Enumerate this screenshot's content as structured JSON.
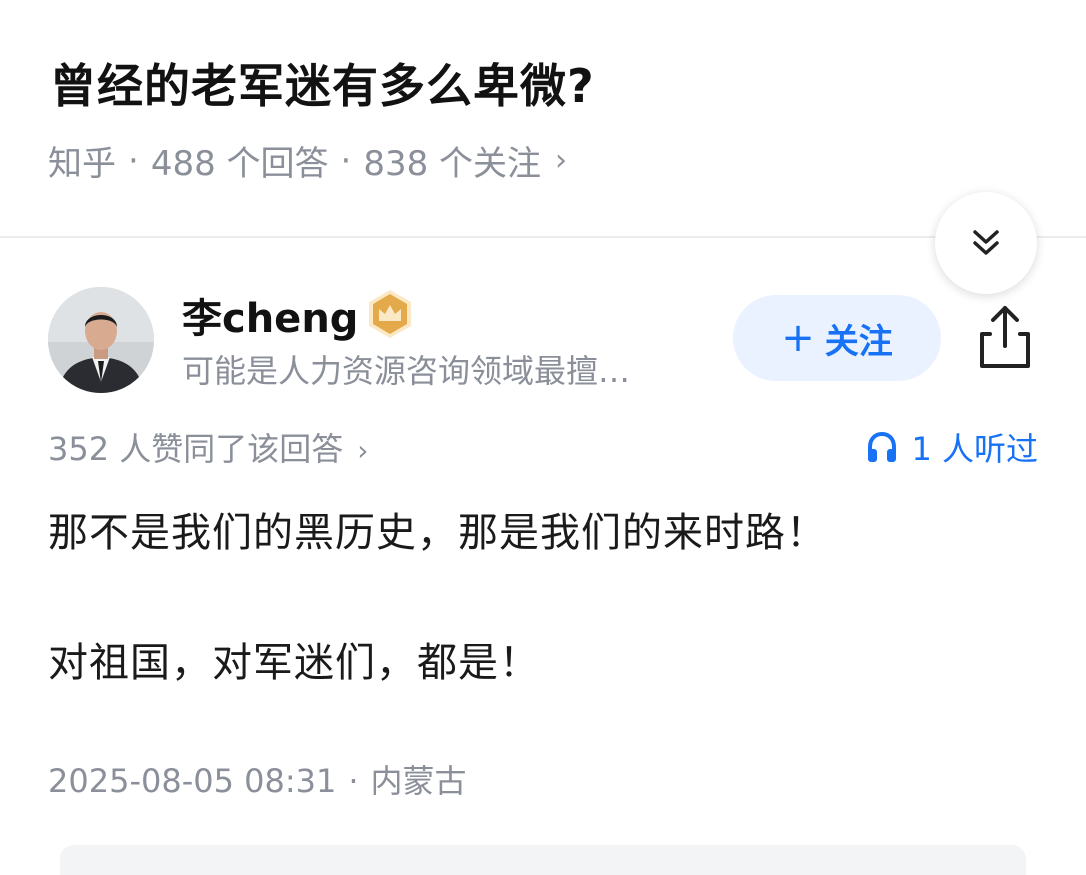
{
  "question": {
    "title": "曾经的老军迷有多么卑微?",
    "source": "知乎",
    "separator": "·",
    "answers_count": "488 个回答",
    "followers_count": "838 个关注",
    "chevron": "›"
  },
  "author": {
    "name": "李cheng",
    "bio": "可能是人力资源咨询领域最擅…",
    "badge_icon": "crown-icon",
    "follow_plus": "+",
    "follow_label": "关注"
  },
  "answer": {
    "upvotes": "352 人赞同了该回答",
    "upvotes_chevron": "›",
    "listen": "1 人听过",
    "paragraphs": [
      "那不是我们的黑历史，那是我们的来时路！",
      "对祖国，对军迷们，都是！"
    ],
    "timestamp": "2025-08-05 08:31",
    "separator": "·",
    "location": "内蒙古"
  },
  "colors": {
    "accent": "#1772f6",
    "follow_bg": "#eaf2ff",
    "meta_gray": "#8a8f99",
    "badge_gold": "#e3a94b"
  }
}
